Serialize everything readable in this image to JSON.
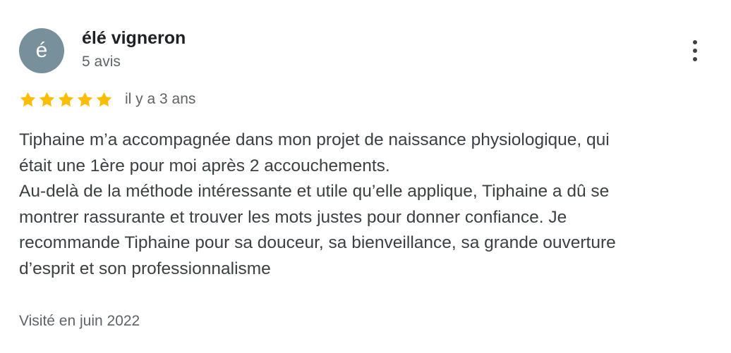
{
  "reviewer": {
    "initial": "é",
    "name": "élé vigneron",
    "review_count": "5 avis",
    "avatar_color": "#78909c"
  },
  "menu": {
    "icon": "more-vertical-icon"
  },
  "rating": {
    "stars": 5,
    "max_stars": 5,
    "star_color": "#fbbc04",
    "time_ago": "il y a 3 ans"
  },
  "review": {
    "lines": [
      "Tiphaine m’a accompagnée dans mon projet de naissance physiologique, qui",
      "était une 1ère pour moi après 2 accouchements.",
      "Au-delà de la méthode intéressante et utile qu’elle applique, Tiphaine a dû se",
      "montrer rassurante et trouver les mots justes pour donner confiance. Je",
      "recommande Tiphaine pour sa douceur, sa bienveillance, sa grande ouverture",
      "d’esprit et son professionnalisme"
    ]
  },
  "visit": {
    "text": "Visité en juin 2022"
  }
}
